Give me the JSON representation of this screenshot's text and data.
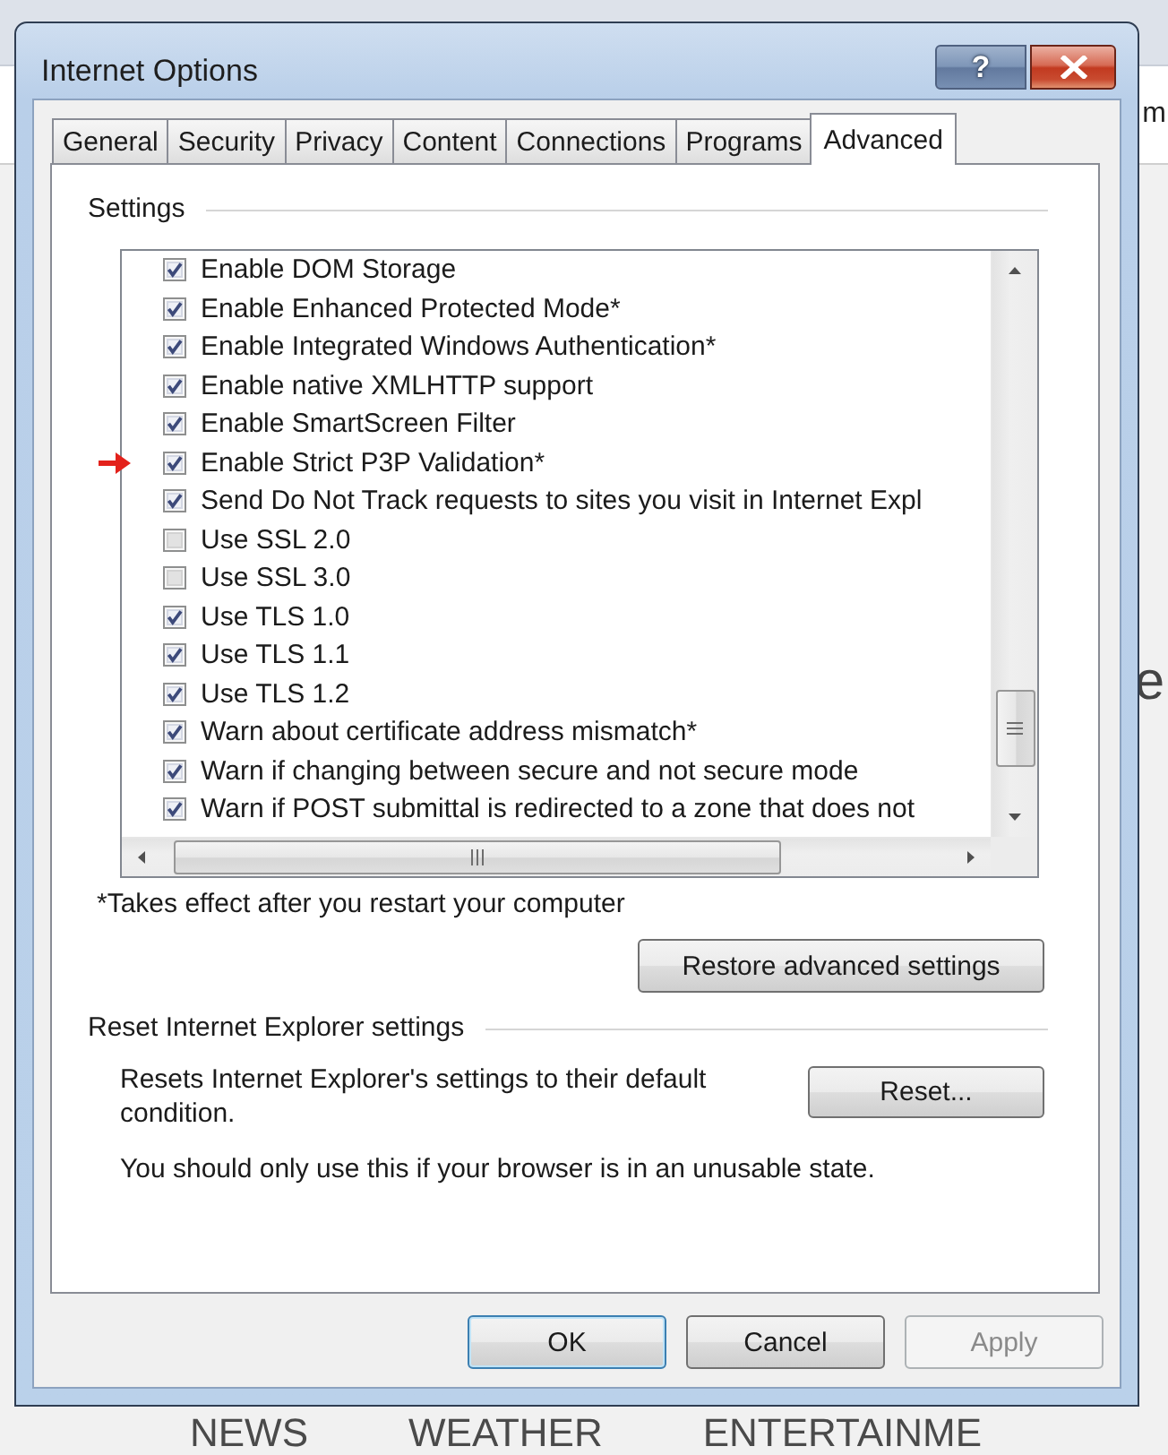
{
  "window": {
    "title": "Internet Options",
    "help_button": "?"
  },
  "tabs": [
    {
      "label": "General",
      "selected": false
    },
    {
      "label": "Security",
      "selected": false
    },
    {
      "label": "Privacy",
      "selected": false
    },
    {
      "label": "Content",
      "selected": false
    },
    {
      "label": "Connections",
      "selected": false
    },
    {
      "label": "Programs",
      "selected": false
    },
    {
      "label": "Advanced",
      "selected": true
    }
  ],
  "settings": {
    "heading": "Settings",
    "items": [
      {
        "label": "Enable DOM Storage",
        "checked": true,
        "marked": false
      },
      {
        "label": "Enable Enhanced Protected Mode*",
        "checked": true,
        "marked": false
      },
      {
        "label": "Enable Integrated Windows Authentication*",
        "checked": true,
        "marked": false
      },
      {
        "label": "Enable native XMLHTTP support",
        "checked": true,
        "marked": false
      },
      {
        "label": "Enable SmartScreen Filter",
        "checked": true,
        "marked": false
      },
      {
        "label": "Enable Strict P3P Validation*",
        "checked": true,
        "marked": true
      },
      {
        "label": "Send Do Not Track requests to sites you visit in Internet Expl",
        "checked": true,
        "marked": false
      },
      {
        "label": "Use SSL 2.0",
        "checked": false,
        "marked": false
      },
      {
        "label": "Use SSL 3.0",
        "checked": false,
        "marked": false
      },
      {
        "label": "Use TLS 1.0",
        "checked": true,
        "marked": false
      },
      {
        "label": "Use TLS 1.1",
        "checked": true,
        "marked": false
      },
      {
        "label": "Use TLS 1.2",
        "checked": true,
        "marked": false
      },
      {
        "label": "Warn about certificate address mismatch*",
        "checked": true,
        "marked": false
      },
      {
        "label": "Warn if changing between secure and not secure mode",
        "checked": true,
        "marked": false
      },
      {
        "label": "Warn if POST submittal is redirected to a zone that does not",
        "checked": true,
        "marked": false
      }
    ],
    "footnote": "*Takes effect after you restart your computer",
    "restore_button": "Restore advanced settings"
  },
  "reset": {
    "heading": "Reset Internet Explorer settings",
    "description": "Resets Internet Explorer's settings to their default condition.",
    "reset_button": "Reset...",
    "warning": "You should only use this if your browser is in an unusable state."
  },
  "buttons": [
    {
      "label": "OK",
      "focused": true,
      "disabled": false
    },
    {
      "label": "Cancel",
      "focused": false,
      "disabled": false
    },
    {
      "label": "Apply",
      "focused": false,
      "disabled": true
    }
  ],
  "background": {
    "fragments": [
      "m",
      "e"
    ],
    "nav": [
      "NEWS",
      "WEATHER",
      "ENTERTAINME"
    ]
  }
}
